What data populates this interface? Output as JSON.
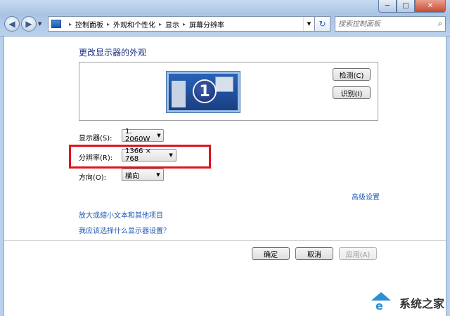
{
  "window": {
    "controls": {
      "minimize": "─",
      "maximize": "□",
      "close": "✕"
    }
  },
  "nav": {
    "back": "◀",
    "forward": "▶",
    "breadcrumbs": [
      "控制面板",
      "外观和个性化",
      "显示",
      "屏幕分辨率"
    ],
    "search_placeholder": "搜索控制面板"
  },
  "page": {
    "title": "更改显示器的外观",
    "monitor_number": "1",
    "detect_button": "检测(C)",
    "identify_button": "识别(I)"
  },
  "fields": {
    "display_label": "显示器(S):",
    "display_value": "1. 2060W",
    "resolution_label": "分辨率(R):",
    "resolution_value": "1366 × 768",
    "orientation_label": "方向(O):",
    "orientation_value": "横向"
  },
  "links": {
    "advanced": "高级设置",
    "text_size": "放大或缩小文本和其他项目",
    "which_settings": "我应该选择什么显示器设置？"
  },
  "buttons": {
    "ok": "确定",
    "cancel": "取消",
    "apply": "应用(A)"
  },
  "watermark": {
    "text": "系统之家"
  },
  "colors": {
    "title_blue": "#1e3287",
    "link_blue": "#1e5bb5",
    "highlight_red": "#e0141e"
  }
}
